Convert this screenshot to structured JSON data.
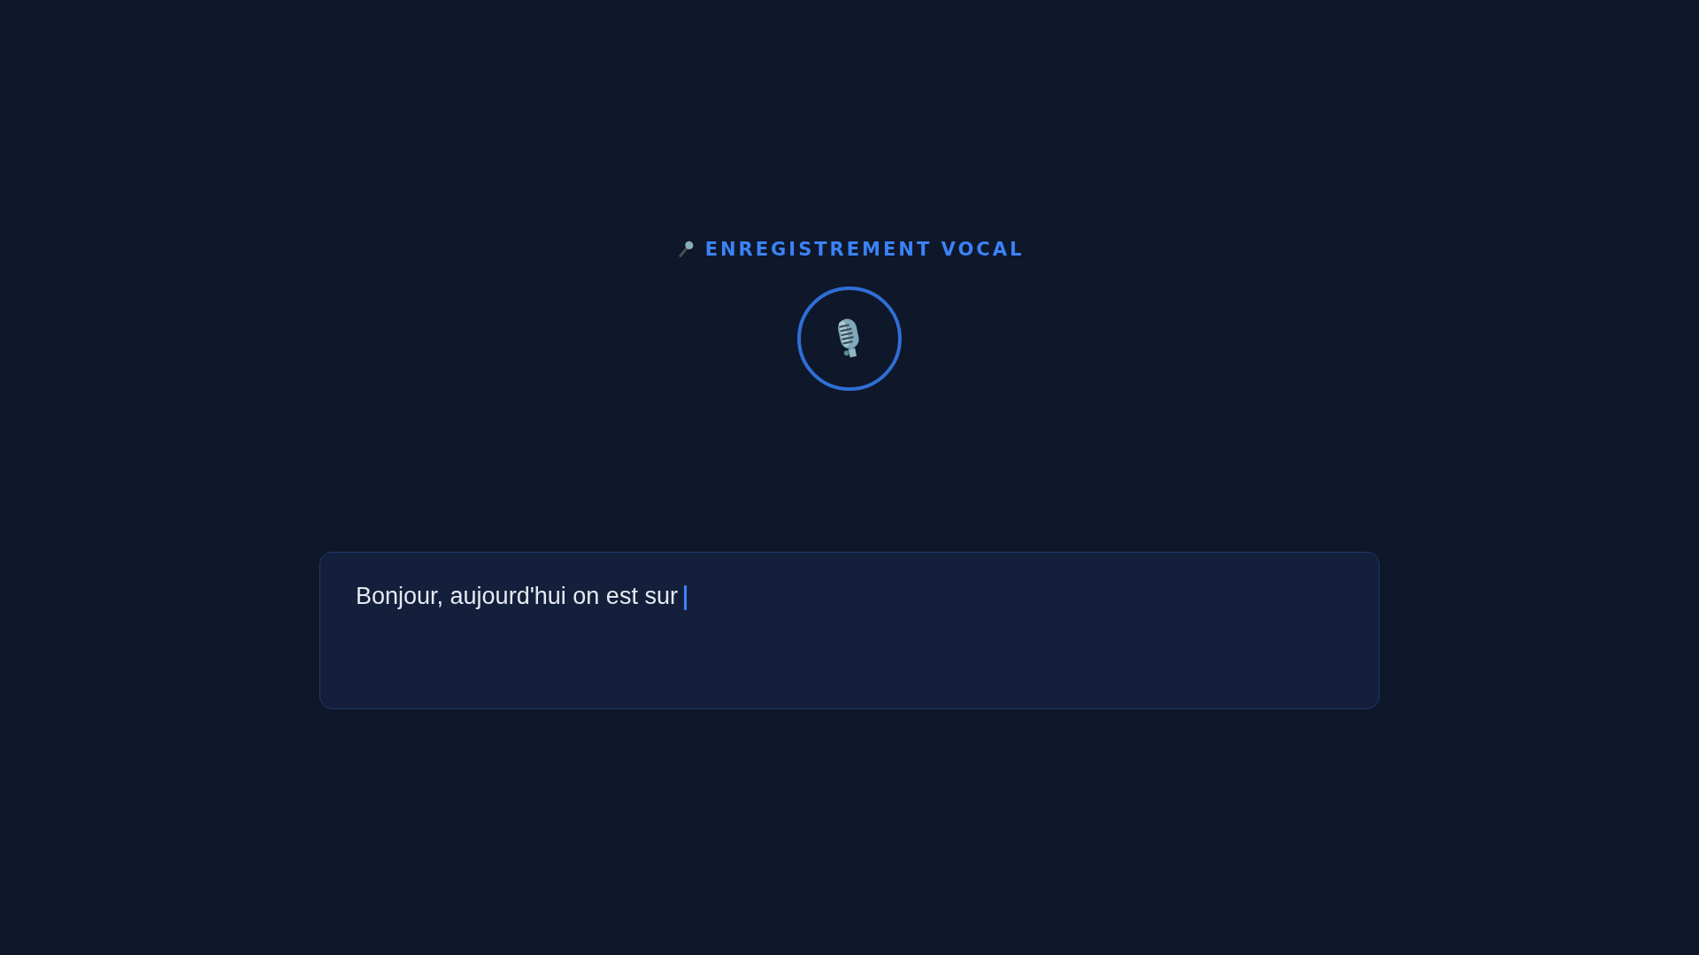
{
  "title": "ENREGISTREMENT VOCAL",
  "record_button": {
    "recording": true
  },
  "transcript": {
    "value": "Bonjour, aujourd'hui on est sur ",
    "caret": true
  }
}
